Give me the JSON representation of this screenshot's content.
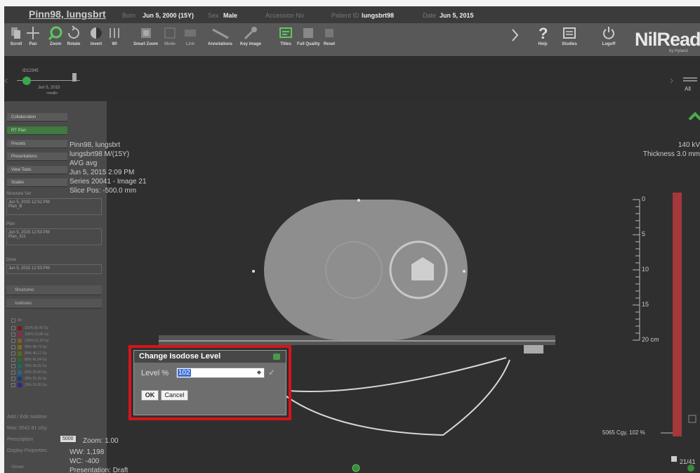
{
  "header": {
    "patient_name": "Pinn98, lungsbrt",
    "born_label": "Born",
    "born_value": "Jun 5, 2000  (15Y)",
    "sex_label": "Sex",
    "sex_value": "Male",
    "accession_label": "Accession No",
    "patient_id_label": "Patient ID",
    "patient_id_value": "lungsbrt98",
    "date_label": "Date",
    "date_value": "Jun 5, 2015"
  },
  "toolbar": {
    "scroll": "Scroll",
    "pan": "Pan",
    "zoom": "Zoom",
    "rotate": "Rotate",
    "invert": "Invert",
    "wl": "Wl",
    "smart_zoom": "Smart Zoom",
    "mode": "Mode",
    "link": "Link",
    "annotations": "Annotations",
    "key_image": "Key Image",
    "titles": "Titles",
    "full_quality": "Full Quality",
    "reset": "Reset",
    "help": "Help",
    "studies": "Studies",
    "logoff": "Logoff",
    "brand": "NilRead",
    "brand_sub": "by Hyland"
  },
  "timeline": {
    "study_id": "ID12345",
    "study_date": "Jun 5, 2015",
    "study_sub": "<multi>",
    "all_label": "All"
  },
  "left_panel": {
    "buttons": [
      "Collaboration",
      "RT Plan",
      "Presets",
      "Presentations",
      "View Tools",
      "Scales"
    ],
    "structure_set_label": "Structure Set",
    "structure_set_value": [
      "Jun 5, 2015 12:52 PM",
      "Plan_B"
    ],
    "plan_label": "Plan",
    "plan_value": [
      "Jun 5, 2015 12:53 PM",
      "Plan_IU1"
    ],
    "dose_label": "Dose",
    "dose_value": [
      "Jun 5, 2015 12:53 PM"
    ],
    "structures": "Structures",
    "isodoses": "Isodoses",
    "legend_all": "All",
    "legend": [
      {
        "label": "110% 56.43 Gy",
        "color": "#7a1a1a"
      },
      {
        "label": "105% 53.86 Gy",
        "color": "#8a2a4a"
      },
      {
        "label": "100% 51.30 Gy",
        "color": "#8a5a1a"
      },
      {
        "label": "95% 48.73 Gy",
        "color": "#7a6a1a"
      },
      {
        "label": "90% 46.17 Gy",
        "color": "#5a6a1a"
      },
      {
        "label": "80% 41.04 Gy",
        "color": "#2a6a2a"
      },
      {
        "label": "70% 35.91 Gy",
        "color": "#1a6a5a"
      },
      {
        "label": "50% 25.65 Gy",
        "color": "#1a6a8a"
      },
      {
        "label": "30% 15.39 Gy",
        "color": "#1a3a8a"
      },
      {
        "label": "20% 10.26 Gy",
        "color": "#2a2a8a"
      }
    ],
    "add_edit": "Add / Edit Isodose",
    "max": "Max: 5542.81 cGy",
    "prescription_label": "Prescription",
    "prescription_value": "5000",
    "display_properties": "Display Properties",
    "viewer": "Viewer"
  },
  "overlay": {
    "patient": "Pinn98, lungsbrt",
    "id_line": "lungsbrt98 M/(15Y)",
    "avg": "AVG avg",
    "datetime": "Jun 5, 2015 2:09 PM",
    "series": "Series 20041 - Image 21",
    "slice_pos": "Slice Pos: -500.0 mm",
    "kv": "140 kV",
    "thickness": "Thickness 3.0 mm",
    "zoom": "Zoom: 1.00",
    "ww": "WW: 1,198",
    "wc": "WC: -400",
    "presentation": "Presentation: Draft",
    "dose_readout": "5065 Cgy, 102 %",
    "image_count": "21/41"
  },
  "scale": {
    "ticks": [
      "0",
      "5",
      "10",
      "15",
      "20 cm"
    ]
  },
  "dialog": {
    "title": "Change Isodose Level",
    "level_label": "Level %",
    "level_value": "102",
    "ok": "OK",
    "cancel": "Cancel",
    "highlight_color": "#d6141a"
  }
}
